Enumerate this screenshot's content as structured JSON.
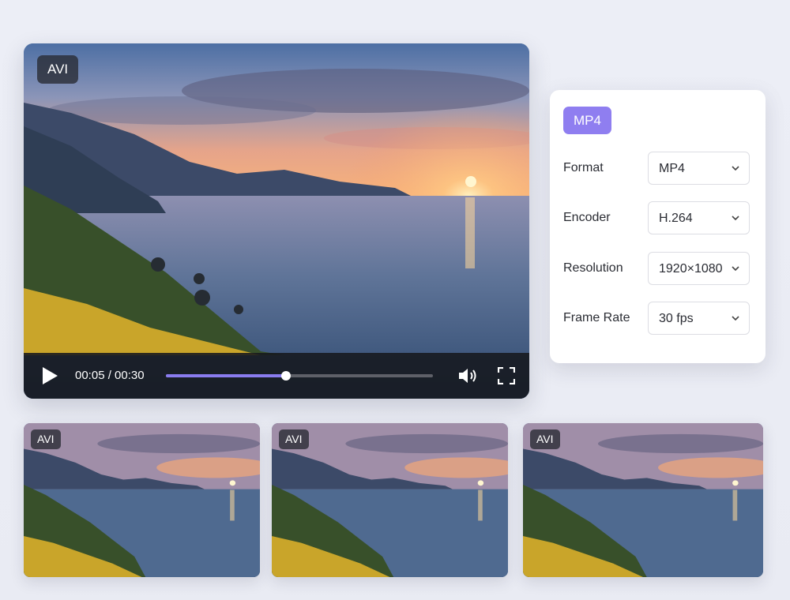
{
  "player": {
    "badge": "AVI",
    "time": "00:05 / 00:30",
    "progress": 0.45
  },
  "panel": {
    "tag": "MP4",
    "rows": [
      {
        "label": "Format",
        "value": "MP4"
      },
      {
        "label": "Encoder",
        "value": "H.264"
      },
      {
        "label": "Resolution",
        "value": "1920×1080"
      },
      {
        "label": "Frame Rate",
        "value": "30 fps"
      }
    ]
  },
  "thumbnails": [
    {
      "badge": "AVI"
    },
    {
      "badge": "AVI"
    },
    {
      "badge": "AVI"
    }
  ],
  "colors": {
    "accent": "#8f7ef0",
    "progress": "#8a7cf0",
    "controls_bg": "#16181e"
  },
  "icons": {
    "play": "play-icon",
    "volume": "volume-icon",
    "fullscreen": "fullscreen-icon",
    "chevron": "chevron-down-icon"
  }
}
